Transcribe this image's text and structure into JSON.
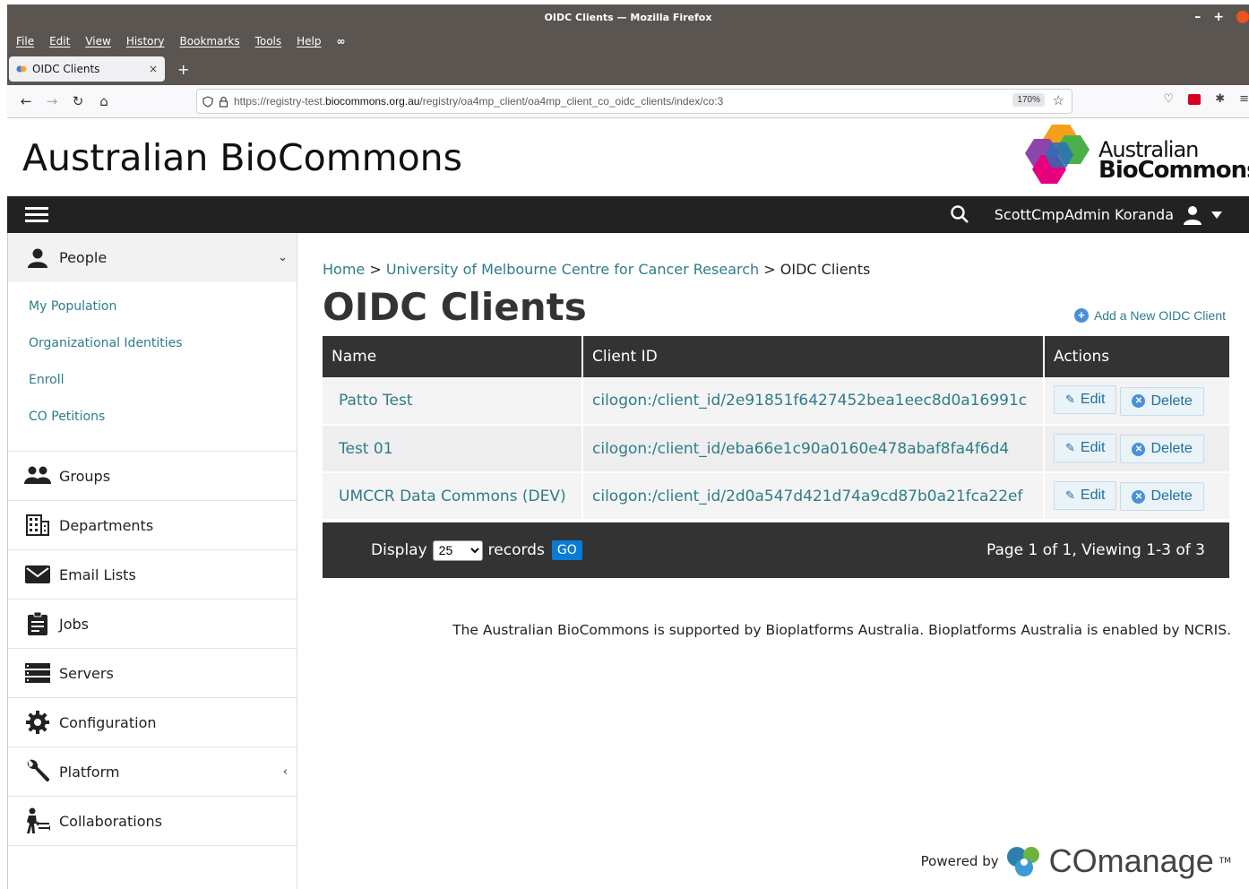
{
  "window": {
    "title": "OIDC Clients — Mozilla Firefox"
  },
  "menubar": [
    "File",
    "Edit",
    "View",
    "History",
    "Bookmarks",
    "Tools",
    "Help"
  ],
  "tab": {
    "title": "OIDC Clients",
    "close": "×",
    "new": "+"
  },
  "nav": {
    "url_prefix": "https://registry-test.",
    "url_domain": "biocommons.org.au",
    "url_path": "/registry/oa4mp_client/oa4mp_client_co_oidc_clients/index/co:3",
    "zoom": "170%"
  },
  "site": {
    "title": "Australian BioCommons",
    "logo_line1": "Australian",
    "logo_line2": "BioCommons",
    "user": "ScottCmpAdmin Koranda"
  },
  "sidebar": {
    "people": {
      "label": "People",
      "items": [
        "My Population",
        "Organizational Identities",
        "Enroll",
        "CO Petitions"
      ]
    },
    "groups": [
      {
        "label": "Groups",
        "icon": "groups-icon"
      },
      {
        "label": "Departments",
        "icon": "departments-icon"
      },
      {
        "label": "Email Lists",
        "icon": "email-icon"
      },
      {
        "label": "Jobs",
        "icon": "jobs-icon"
      },
      {
        "label": "Servers",
        "icon": "servers-icon"
      },
      {
        "label": "Configuration",
        "icon": "gear-icon"
      },
      {
        "label": "Platform",
        "icon": "wrench-icon"
      },
      {
        "label": "Collaborations",
        "icon": "collaborations-icon"
      }
    ]
  },
  "breadcrumb": {
    "home": "Home",
    "sep1": " > ",
    "org": "University of Melbourne Centre for Cancer Research",
    "sep2": " > ",
    "current": "OIDC Clients"
  },
  "page": {
    "title": "OIDC Clients",
    "add_label": "Add a New OIDC Client"
  },
  "table": {
    "headers": [
      "Name",
      "Client ID",
      "Actions"
    ],
    "rows": [
      {
        "name": "Patto Test",
        "client_id": "cilogon:/client_id/2e91851f6427452bea1eec8d0a16991c"
      },
      {
        "name": "Test 01",
        "client_id": "cilogon:/client_id/eba66e1c90a0160e478abaf8fa4f6d4"
      },
      {
        "name": "UMCCR Data Commons (DEV)",
        "client_id": "cilogon:/client_id/2d0a547d421d74a9cd87b0a21fca22ef"
      }
    ],
    "edit_label": "Edit",
    "delete_label": "Delete"
  },
  "pager": {
    "display": "Display",
    "records": "records",
    "page_size": "25",
    "go": "GO",
    "status": "Page 1 of 1, Viewing 1-3 of 3"
  },
  "footer": {
    "text": "The Australian BioCommons is supported by Bioplatforms Australia. Bioplatforms Australia is enabled by NCRIS.",
    "powered_by": "Powered by",
    "brand": "COmanage",
    "tm": "TM"
  }
}
